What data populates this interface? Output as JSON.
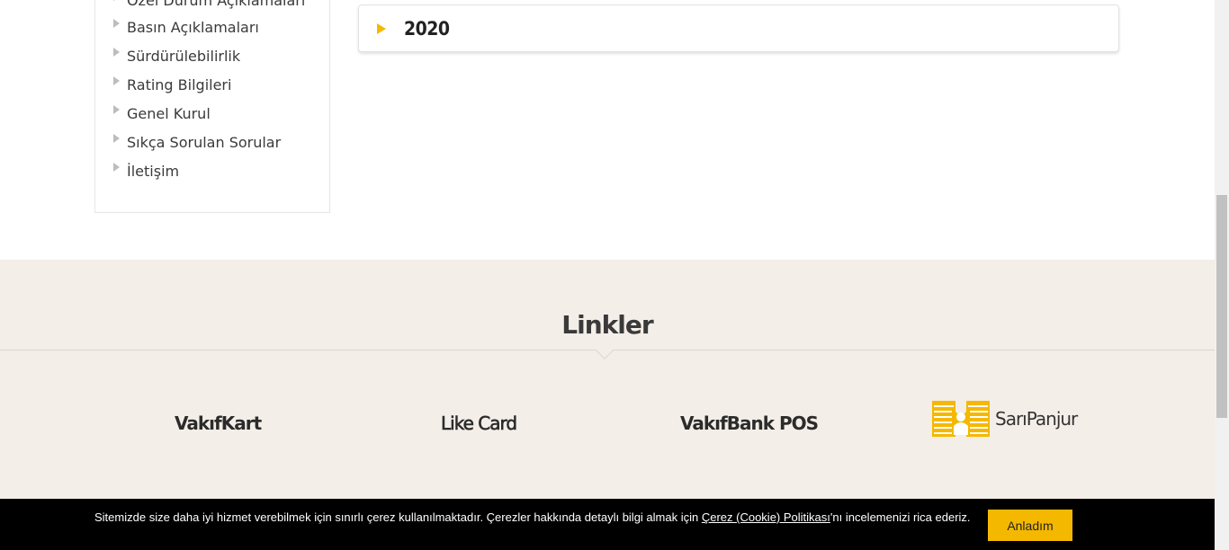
{
  "sidebar": {
    "items": [
      {
        "label": "Özel Durum Açıklamaları"
      },
      {
        "label": "Basın Açıklamaları"
      },
      {
        "label": "Sürdürülebilirlik"
      },
      {
        "label": "Rating Bilgileri"
      },
      {
        "label": "Genel Kurul"
      },
      {
        "label": "Sıkça Sorulan Sorular"
      },
      {
        "label": "İletişim"
      }
    ]
  },
  "accordion": {
    "year": "2020",
    "icon": "triangle-right-icon",
    "accent_color": "#f5b800"
  },
  "links": {
    "title": "Linkler",
    "items": [
      {
        "label": "VakıfKart"
      },
      {
        "label": "Like Card"
      },
      {
        "label": "VakıfBank POS"
      },
      {
        "label": "SarıPanjur",
        "icon": "sari-panjur-logo-icon"
      }
    ],
    "background_color": "#f4eee8"
  },
  "cookie": {
    "text_before": "Sitemizde size daha iyi hizmet verebilmek için sınırlı çerez kullanılmaktadır. Çerezler hakkında detaylı bilgi almak için ",
    "link_text": "Çerez (Cookie) Politikası",
    "text_after": "'nı incelemenizi rica ederiz.",
    "button_label": "Anladım",
    "button_color": "#f5b800"
  }
}
